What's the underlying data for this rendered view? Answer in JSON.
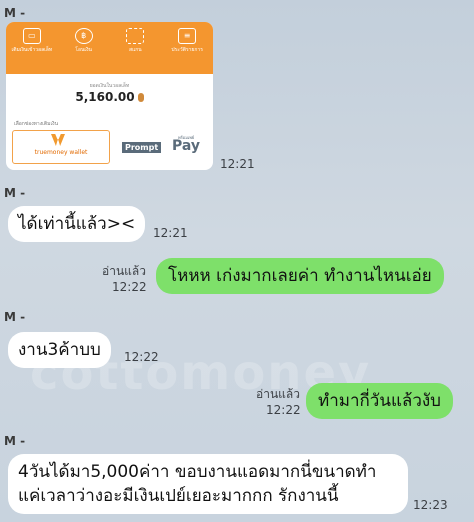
{
  "senders": [
    "M -",
    "M -",
    "M -",
    "M -"
  ],
  "attachment": {
    "menu": [
      {
        "icon": "wallet-icon",
        "label": "เติมเงินเข้าวอลเล็ท"
      },
      {
        "icon": "coin-icon",
        "label": "โอนเงิน"
      },
      {
        "icon": "scan-icon",
        "label": "สแกน"
      },
      {
        "icon": "receipt-icon",
        "label": "ประวัติรายการ"
      }
    ],
    "balance_label": "ยอดเงินในวอลเล็ท",
    "balance": "5,160.00",
    "select_label": "เลือกช่องทางเติมเงิน",
    "truemoney": "truemoney wallet",
    "promptpay_prompt": "Prompt",
    "promptpay_pay": "Pay",
    "promptpay_small": "พร้อมเพย์",
    "time": "12:21"
  },
  "messages": [
    {
      "dir": "in",
      "text": "ได้เท่านี้แล้ว><",
      "time": "12:21"
    },
    {
      "dir": "out",
      "text": "โหหห เก่งมากเลยค่า ทำงานไหนเอ่ย",
      "read": "อ่านแล้ว",
      "time": "12:22"
    },
    {
      "dir": "in",
      "text": "งาน3ค้าบบ",
      "time": "12:22"
    },
    {
      "dir": "out",
      "text": "ทำมากี่วันแล้วงับ",
      "read": "อ่านแล้ว",
      "time": "12:22"
    },
    {
      "dir": "in",
      "line1": "4วันได้มา5,000ค่าา ขอบงานแอดมากนี่ขนาดทำ",
      "line2": "แค่เวลาว่างอะมีเงินเปย์เยอะมากกก รักงานนี้",
      "time": "12:23"
    }
  ],
  "watermark": "cottomoney",
  "colors": {
    "outgoing": "#7ee06a",
    "incoming": "#ffffff",
    "card_header": "#f4962f"
  }
}
